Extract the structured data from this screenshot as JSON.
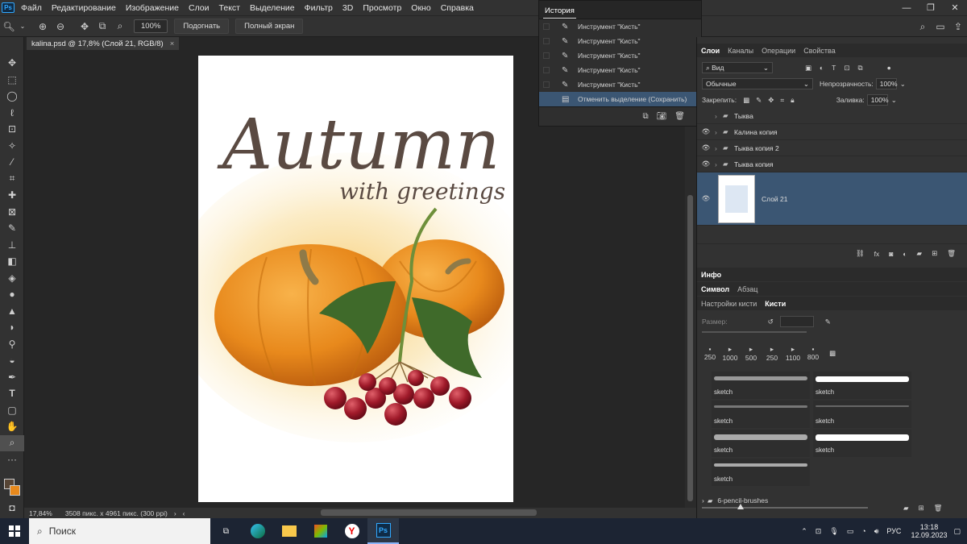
{
  "menu": {
    "items": [
      "Файл",
      "Редактирование",
      "Изображение",
      "Слои",
      "Текст",
      "Выделение",
      "Фильтр",
      "3D",
      "Просмотр",
      "Окно",
      "Справка"
    ],
    "logo": "Ps"
  },
  "options": {
    "zoom_value": "100%",
    "fit_label": "Подогнать",
    "fullscreen_label": "Полный экран"
  },
  "document": {
    "tab_title": "kalina.psd @ 17,8% (Слой 21, RGB/8)",
    "artwork_title": "Autumn",
    "artwork_subtitle": "with greetings"
  },
  "status": {
    "zoom": "17,84%",
    "size": "3508 пикс. x 4961 пикс. (300 ppi)"
  },
  "history": {
    "title": "История",
    "entries": [
      "Инструмент \"Кисть\"",
      "Инструмент \"Кисть\"",
      "Инструмент \"Кисть\"",
      "Инструмент \"Кисть\"",
      "Инструмент \"Кисть\""
    ],
    "selected": "Отменить выделение (Сохранить)"
  },
  "layers_panel": {
    "tabs": [
      "Слои",
      "Каналы",
      "Операции",
      "Свойства"
    ],
    "filter": "Вид",
    "blend_mode": "Обычные",
    "opacity_label": "Непрозрачность:",
    "opacity_value": "100%",
    "lock_label": "Закрепить:",
    "fill_label": "Заливка:",
    "fill_value": "100%",
    "layers": [
      "Тыква",
      "Калина копия",
      "Тыква копия 2",
      "Тыква копия"
    ],
    "selected_layer": "Слой 21"
  },
  "info_panel": {
    "title": "Инфо"
  },
  "char_panel": {
    "tabs": [
      "Символ",
      "Абзац"
    ]
  },
  "brush_panel": {
    "tabs": [
      "Настройки кисти",
      "Кисти"
    ],
    "size_label": "Размер:",
    "presets": [
      "250",
      "1000",
      "500",
      "250",
      "1100",
      "800"
    ],
    "brushes": [
      "sketch",
      "sketch",
      "sketch",
      "sketch",
      "sketch",
      "sketch",
      "sketch"
    ],
    "folder": "6-pencil-brushes"
  },
  "taskbar": {
    "search_placeholder": "Поиск",
    "lang": "РУС",
    "time": "13:18",
    "date": "12.09.2023"
  },
  "colors": {
    "selection": "#3b5673",
    "pumpkin": "#e8891c",
    "leaf": "#3f6a2a",
    "berry": "#a01a2a"
  }
}
